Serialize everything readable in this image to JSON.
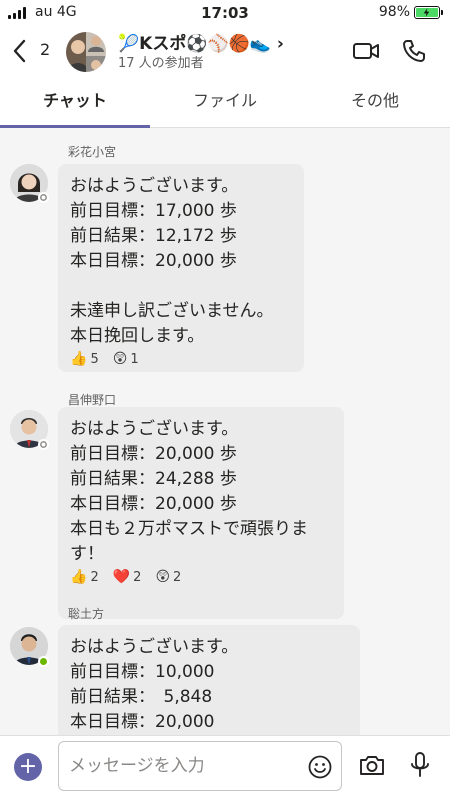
{
  "status_bar": {
    "carrier": "au 4G",
    "time": "17:03",
    "battery_percent": "98%",
    "battery_level": 0.98
  },
  "header": {
    "back_count": "2",
    "group_name": "🎾Kスポ⚽️⚾️🏀👟 ›",
    "participants": "17 人の参加者"
  },
  "tabs": [
    {
      "label": "チャット",
      "active": true
    },
    {
      "label": "ファイル",
      "active": false
    },
    {
      "label": "その他",
      "active": false
    }
  ],
  "messages": [
    {
      "sender": "彩花小宮",
      "presence": "away",
      "lines": [
        "おはようございます。",
        "前日目標：17,000 歩",
        "前日結果：12,172 歩",
        "本日目標：20,000 歩",
        "",
        "未達申し訳ございません。",
        "本日挽回します。"
      ],
      "reactions": [
        {
          "icon": "👍",
          "count": "5"
        },
        {
          "icon": "😲",
          "count": "1"
        }
      ]
    },
    {
      "sender": "昌伸野口",
      "presence": "away",
      "lines": [
        "おはようございます。",
        "前日目標：20,000 歩",
        "前日結果：24,288 歩",
        "本日目標：20,000 歩",
        "本日も２万ポマストで頑張りま",
        "す！"
      ],
      "reactions": [
        {
          "icon": "👍",
          "count": "2"
        },
        {
          "icon": "❤️",
          "count": "2"
        },
        {
          "icon": "😲",
          "count": "2"
        }
      ]
    },
    {
      "sender": "聡土方",
      "presence": "online",
      "lines": [
        "おはようございます。",
        "前日目標：10,000",
        "前日結果：　5,848",
        "本日目標：20,000"
      ],
      "reactions": []
    }
  ],
  "composer": {
    "placeholder": "メッセージを入力"
  },
  "colors": {
    "accent": "#6264a7",
    "bubble": "#ebebeb",
    "background": "#f5f5f5",
    "online": "#6bb700"
  }
}
